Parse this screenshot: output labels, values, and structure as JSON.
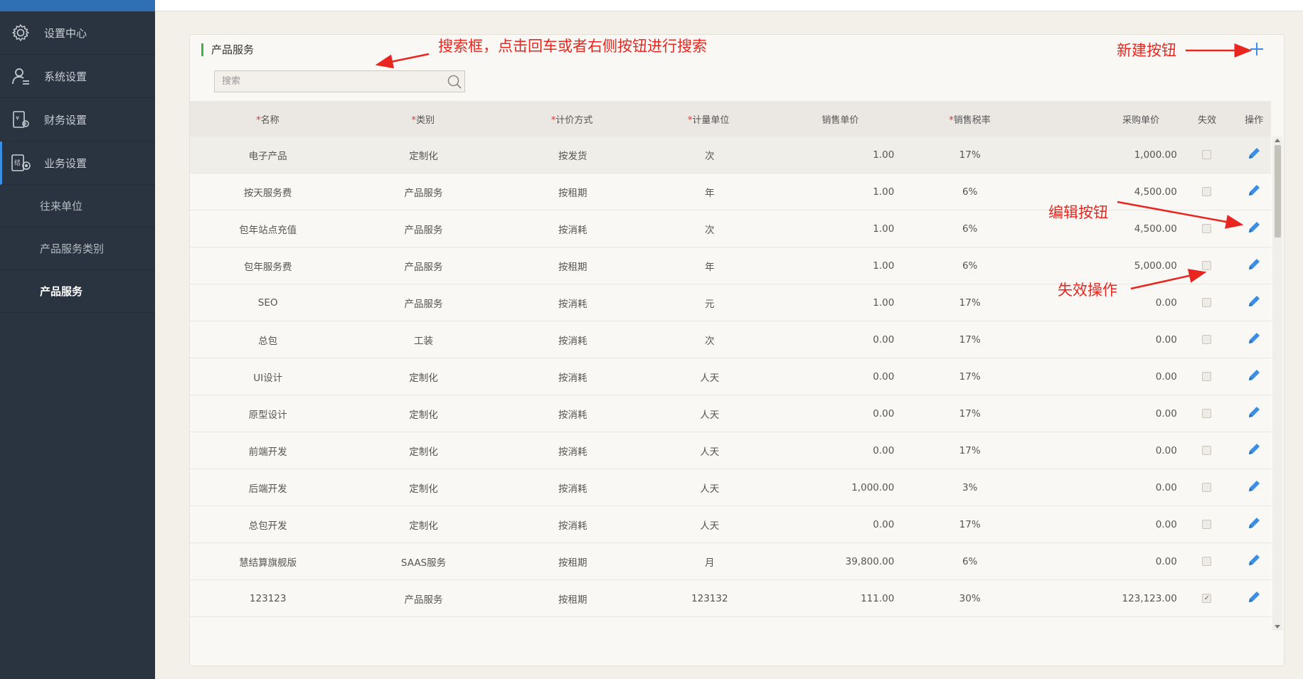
{
  "sidebar": {
    "items": [
      {
        "label": "设置中心",
        "icon": "gear-icon"
      },
      {
        "label": "系统设置",
        "icon": "user-settings-icon"
      },
      {
        "label": "财务设置",
        "icon": "finance-doc-icon"
      },
      {
        "label": "业务设置",
        "icon": "business-icon"
      }
    ],
    "sub_items": [
      {
        "label": "往来单位"
      },
      {
        "label": "产品服务类别"
      },
      {
        "label": "产品服务"
      }
    ]
  },
  "panel": {
    "title": "产品服务",
    "search_placeholder": "搜索"
  },
  "table": {
    "headers": {
      "name": "名称",
      "type": "类别",
      "pricing": "计价方式",
      "unit": "计量单位",
      "sale_price": "销售单价",
      "tax": "销售税率",
      "purchase_price": "采购单价",
      "invalid": "失效",
      "action": "操作"
    },
    "required_mark": "*",
    "rows": [
      {
        "name": "电子产品",
        "type": "定制化",
        "pricing": "按发货",
        "unit": "次",
        "sale": "1.00",
        "tax": "17%",
        "buy": "1,000.00",
        "invalid": false
      },
      {
        "name": "按天服务费",
        "type": "产品服务",
        "pricing": "按租期",
        "unit": "年",
        "sale": "1.00",
        "tax": "6%",
        "buy": "4,500.00",
        "invalid": false
      },
      {
        "name": "包年站点充值",
        "type": "产品服务",
        "pricing": "按消耗",
        "unit": "次",
        "sale": "1.00",
        "tax": "6%",
        "buy": "4,500.00",
        "invalid": false
      },
      {
        "name": "包年服务费",
        "type": "产品服务",
        "pricing": "按租期",
        "unit": "年",
        "sale": "1.00",
        "tax": "6%",
        "buy": "5,000.00",
        "invalid": false
      },
      {
        "name": "SEO",
        "type": "产品服务",
        "pricing": "按消耗",
        "unit": "元",
        "sale": "1.00",
        "tax": "17%",
        "buy": "0.00",
        "invalid": false
      },
      {
        "name": "总包",
        "type": "工装",
        "pricing": "按消耗",
        "unit": "次",
        "sale": "0.00",
        "tax": "17%",
        "buy": "0.00",
        "invalid": false
      },
      {
        "name": "UI设计",
        "type": "定制化",
        "pricing": "按消耗",
        "unit": "人天",
        "sale": "0.00",
        "tax": "17%",
        "buy": "0.00",
        "invalid": false
      },
      {
        "name": "原型设计",
        "type": "定制化",
        "pricing": "按消耗",
        "unit": "人天",
        "sale": "0.00",
        "tax": "17%",
        "buy": "0.00",
        "invalid": false
      },
      {
        "name": "前端开发",
        "type": "定制化",
        "pricing": "按消耗",
        "unit": "人天",
        "sale": "0.00",
        "tax": "17%",
        "buy": "0.00",
        "invalid": false
      },
      {
        "name": "后端开发",
        "type": "定制化",
        "pricing": "按消耗",
        "unit": "人天",
        "sale": "1,000.00",
        "tax": "3%",
        "buy": "0.00",
        "invalid": false
      },
      {
        "name": "总包开发",
        "type": "定制化",
        "pricing": "按消耗",
        "unit": "人天",
        "sale": "0.00",
        "tax": "17%",
        "buy": "0.00",
        "invalid": false
      },
      {
        "name": "慧结算旗舰版",
        "type": "SAAS服务",
        "pricing": "按租期",
        "unit": "月",
        "sale": "39,800.00",
        "tax": "6%",
        "buy": "0.00",
        "invalid": false
      },
      {
        "name": "123123",
        "type": "产品服务",
        "pricing": "按租期",
        "unit": "123132",
        "sale": "111.00",
        "tax": "30%",
        "buy": "123,123.00",
        "invalid": true
      }
    ]
  },
  "annotations": {
    "search": "搜索框，点击回车或者右侧按钮进行搜索",
    "create": "新建按钮",
    "edit": "编辑按钮",
    "invalidate": "失效操作"
  },
  "colors": {
    "sidebar_bg": "#2a3440",
    "accent_blue": "#3a8ee6",
    "title_bar_green": "#45b344",
    "required_red": "#e03030",
    "annotation_red": "#e8261f"
  }
}
